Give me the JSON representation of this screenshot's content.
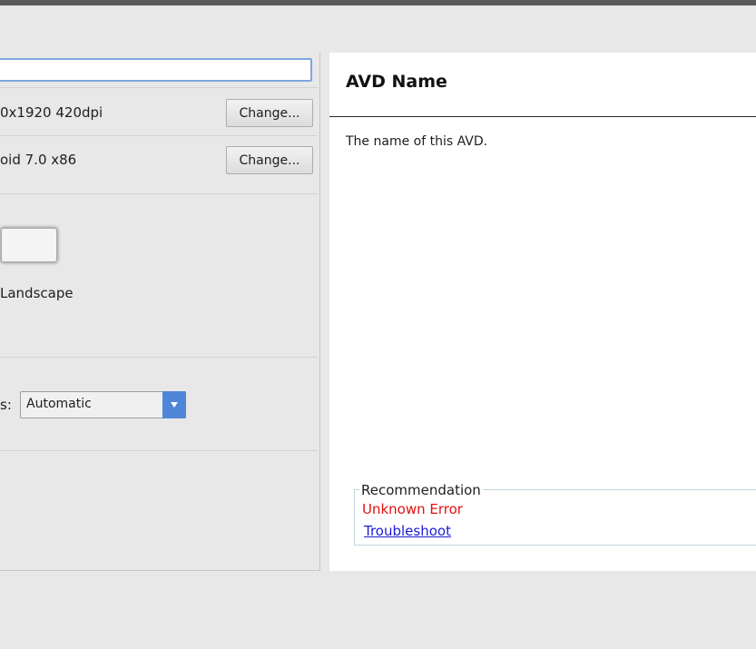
{
  "device_config": {
    "avd_name_value": "",
    "device_spec": "0x1920 420dpi",
    "system_image": "oid 7.0 x86",
    "change_label": "Change...",
    "orientation_label": "Landscape",
    "graphics_label": "s:",
    "graphics_selected": "Automatic"
  },
  "help_panel": {
    "title": "AVD Name",
    "description": "The name of this AVD.",
    "recommendation": {
      "legend": "Recommendation",
      "error": "Unknown Error",
      "link": "Troubleshoot"
    }
  },
  "colors": {
    "error": "#e01010",
    "link": "#1a1ad8",
    "select_accent": "#4f86d8"
  }
}
